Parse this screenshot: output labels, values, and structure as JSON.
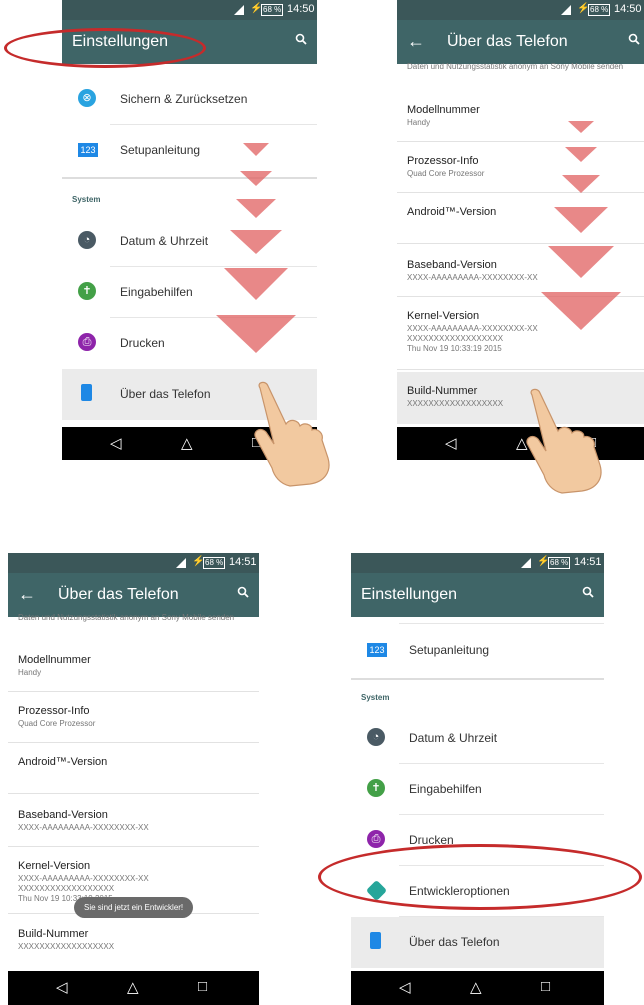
{
  "status": {
    "battery": "68 %",
    "time_a": "14:50",
    "time_b": "14:51"
  },
  "screens": {
    "settings": {
      "title": "Einstellungen",
      "items": {
        "backup": "Sichern & Zurücksetzen",
        "setup": "Setupanleitung",
        "system_header": "System",
        "date": "Datum & Uhrzeit",
        "access": "Eingabehilfen",
        "print": "Drucken",
        "dev": "Entwickleroptionen",
        "about": "Über das Telefon"
      }
    },
    "about": {
      "title": "Über das Telefon",
      "cut_text": "Daten und Nutzungsstatistik anonym an Sony Mobile senden",
      "model_label": "Modellnummer",
      "model_value": "Handy",
      "cpu_label": "Prozessor-Info",
      "cpu_value": "Quad Core Prozessor",
      "android_label": "Android™-Version",
      "baseband_label": "Baseband-Version",
      "baseband_value": "XXXX-AAAAAAAAA-XXXXXXXX-XX",
      "kernel_label": "Kernel-Version",
      "kernel_value1": "XXXX-AAAAAAAAA-XXXXXXXX-XX",
      "kernel_value2": "XXXXXXXXXXXXXXXXXX",
      "kernel_value3": "Thu Nov 19 10:33:19 2015",
      "build_label": "Build-Nummer",
      "build_value": "XXXXXXXXXXXXXXXXXX",
      "toast": "Sie sind jetzt ein Entwickler!"
    }
  },
  "icons": {
    "back": "←",
    "nav_back": "◁",
    "nav_home": "△",
    "nav_recent": "□",
    "bolt": "⚡",
    "k123": "123"
  },
  "colors": {
    "toolbar": "#3f6567",
    "highlight": "#c52b2b",
    "arrow": "#e06060"
  }
}
